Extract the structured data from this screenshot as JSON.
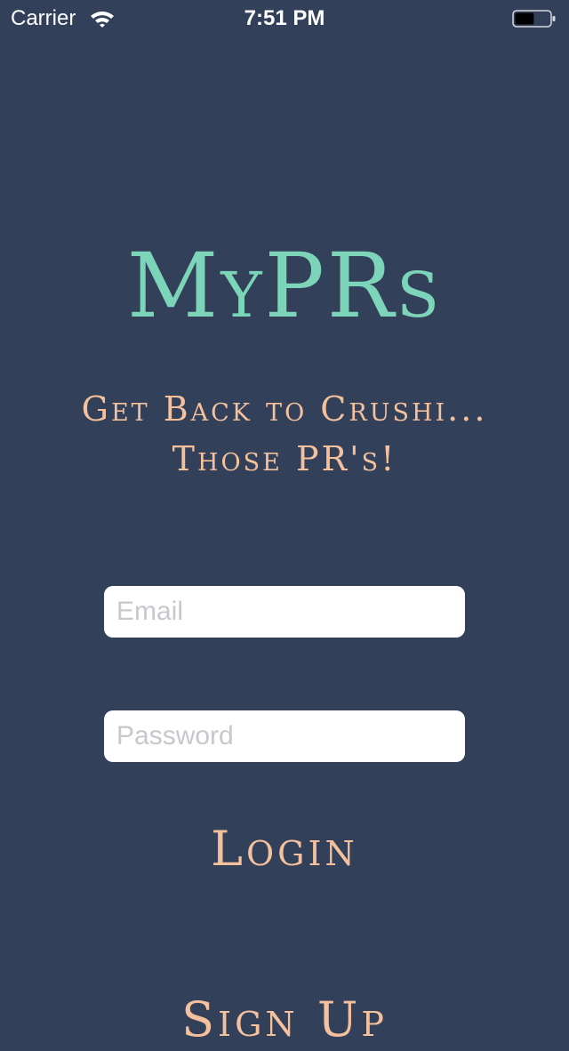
{
  "status_bar": {
    "carrier": "Carrier",
    "time": "7:51 PM",
    "wifi_icon": "wifi-icon",
    "battery_icon": "battery-icon",
    "battery_level": 0.55
  },
  "app": {
    "title": "MyPRs",
    "tagline_line1": "Get Back to Crushi...",
    "tagline_line2": "Those PR's!"
  },
  "form": {
    "email": {
      "value": "",
      "placeholder": "Email"
    },
    "password": {
      "value": "",
      "placeholder": "Password"
    },
    "login_label": "Login",
    "signup_label": "Sign Up"
  },
  "colors": {
    "background": "#32405a",
    "title": "#7dd5b9",
    "accent": "#f4c19c",
    "field_bg": "#ffffff",
    "placeholder": "#c7c7cd"
  }
}
